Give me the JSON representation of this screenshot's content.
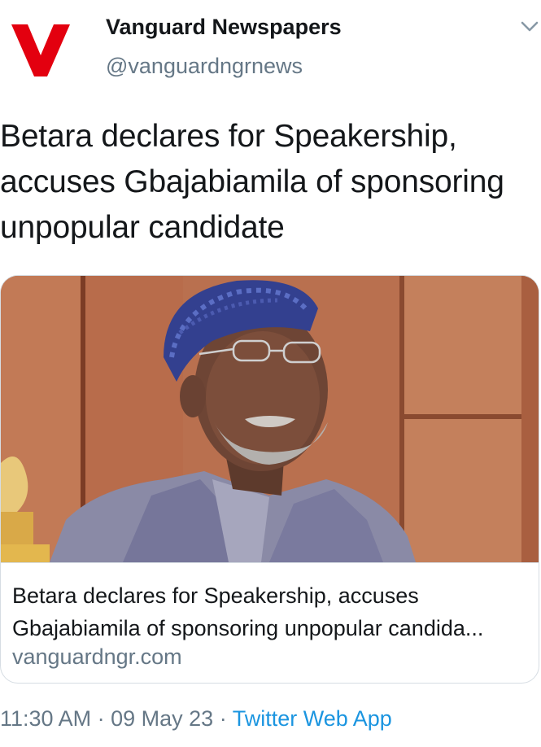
{
  "account": {
    "display_name": "Vanguard Newspapers",
    "handle": "@vanguardngrnews",
    "avatar_letter": "V",
    "avatar_color": "#e3000f"
  },
  "tweet": {
    "text": "Betara declares for Speakership, accuses Gbajabiamila of sponsoring unpopular candidate"
  },
  "card": {
    "title_line1": "Betara declares for Speakership, accuses",
    "title_line2": "Gbajabiamila of sponsoring unpopular candida...",
    "domain": "vanguardngr.com"
  },
  "footer": {
    "time": "11:30 AM",
    "separator": "·",
    "date": "09 May 23",
    "source": "Twitter Web App"
  },
  "colors": {
    "primary_text": "#14171a",
    "secondary_text": "#657786",
    "link": "#1b95e0",
    "border": "#d6dde3"
  },
  "icons": {
    "menu": "chevron-down-icon"
  }
}
